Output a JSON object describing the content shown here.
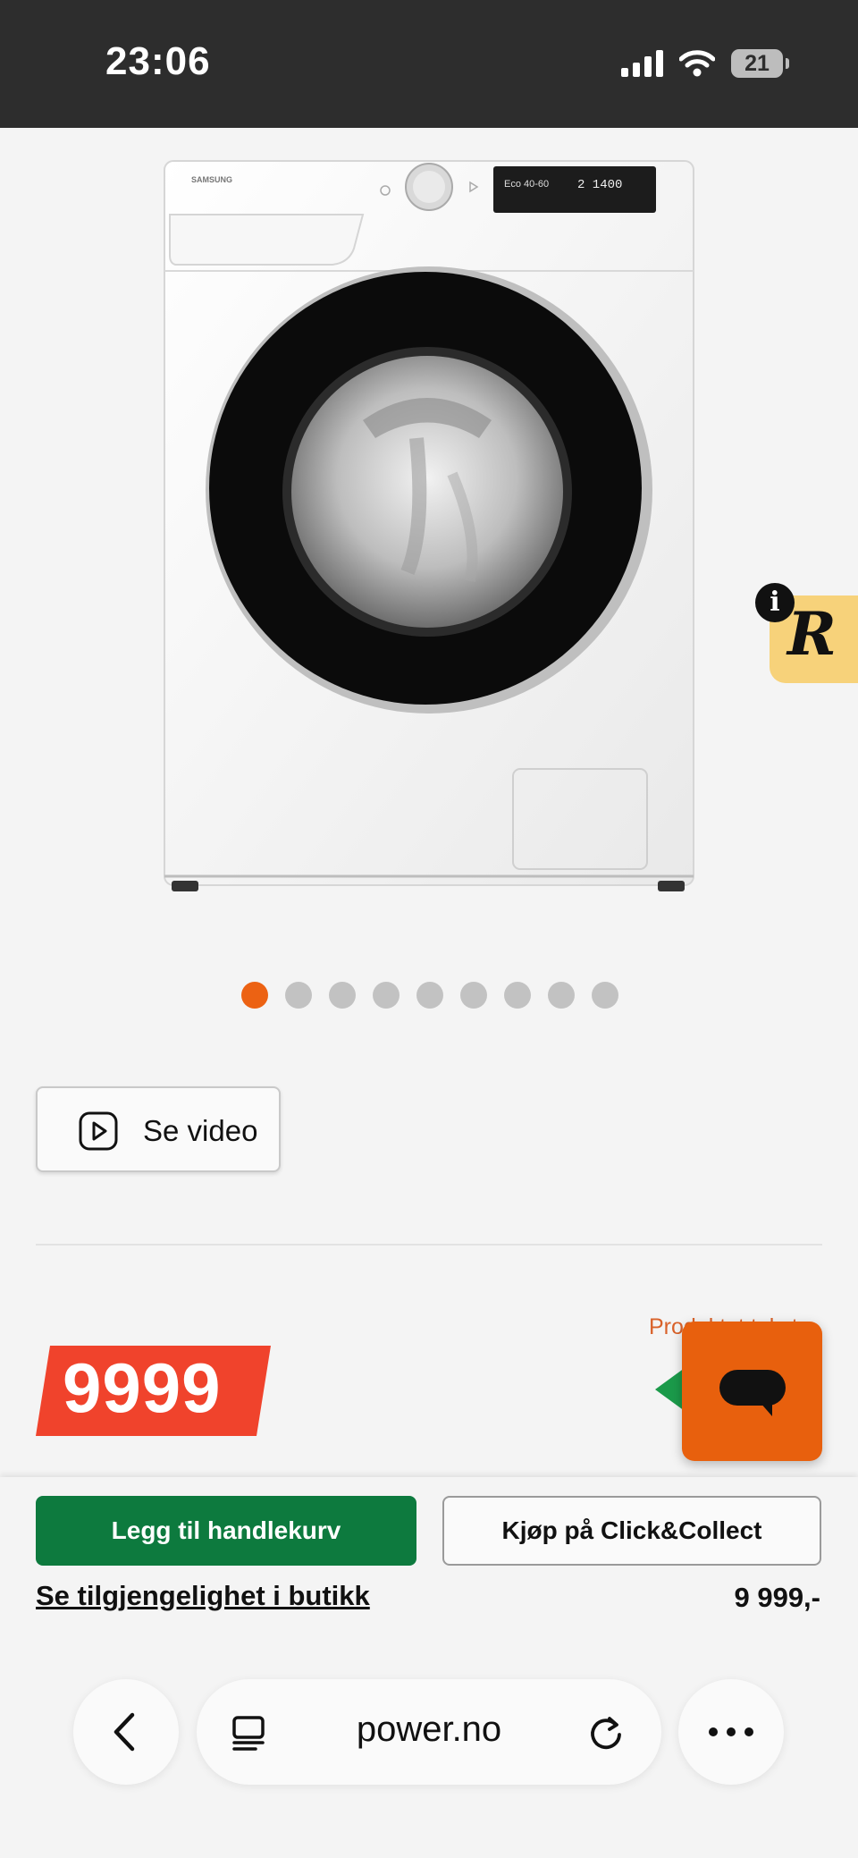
{
  "status_bar": {
    "time": "23:06",
    "battery_level": "21",
    "icons": [
      "signal-icon",
      "wifi-icon",
      "battery-icon"
    ]
  },
  "product": {
    "image_brand_text": "SAMSUNG",
    "image_display_text": "Eco 40-60",
    "image_display_spin": "2 1400",
    "gallery_total": 9,
    "gallery_active_index": 0,
    "video_button_label": "Se video",
    "price_badge": "9999",
    "label_partial": "Produktet tekst",
    "accent_orange": "#ec6213",
    "price_red": "#f0432c",
    "cart_green": "#0d7a3e"
  },
  "overlay": {
    "r_letter": "R",
    "info_letter": "i"
  },
  "actions": {
    "add_to_cart_label": "Legg til handlekurv",
    "click_collect_label": "Kjøp på Click&Collect",
    "availability_link": "Se tilgjengelighet i butikk",
    "price_text": "9 999,-"
  },
  "browser": {
    "url": "power.no",
    "icons": [
      "back-icon",
      "tabs-icon",
      "reload-icon",
      "more-icon"
    ]
  }
}
